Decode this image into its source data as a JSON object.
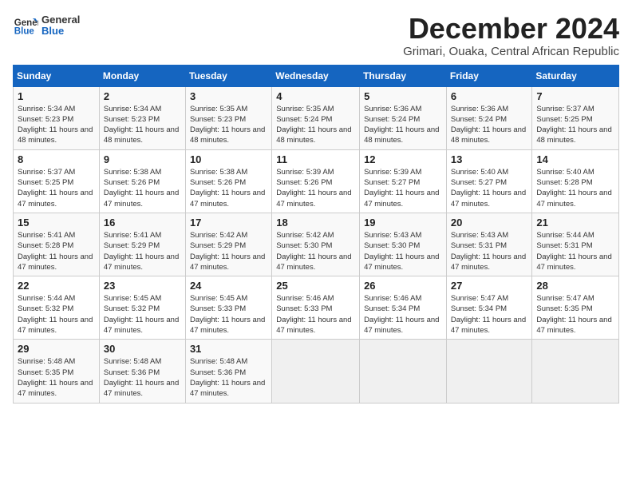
{
  "logo": {
    "general": "General",
    "blue": "Blue"
  },
  "header": {
    "month": "December 2024",
    "location": "Grimari, Ouaka, Central African Republic"
  },
  "weekdays": [
    "Sunday",
    "Monday",
    "Tuesday",
    "Wednesday",
    "Thursday",
    "Friday",
    "Saturday"
  ],
  "weeks": [
    [
      {
        "day": 1,
        "sunrise": "5:34 AM",
        "sunset": "5:23 PM",
        "daylight": "11 hours and 48 minutes."
      },
      {
        "day": 2,
        "sunrise": "5:34 AM",
        "sunset": "5:23 PM",
        "daylight": "11 hours and 48 minutes."
      },
      {
        "day": 3,
        "sunrise": "5:35 AM",
        "sunset": "5:23 PM",
        "daylight": "11 hours and 48 minutes."
      },
      {
        "day": 4,
        "sunrise": "5:35 AM",
        "sunset": "5:24 PM",
        "daylight": "11 hours and 48 minutes."
      },
      {
        "day": 5,
        "sunrise": "5:36 AM",
        "sunset": "5:24 PM",
        "daylight": "11 hours and 48 minutes."
      },
      {
        "day": 6,
        "sunrise": "5:36 AM",
        "sunset": "5:24 PM",
        "daylight": "11 hours and 48 minutes."
      },
      {
        "day": 7,
        "sunrise": "5:37 AM",
        "sunset": "5:25 PM",
        "daylight": "11 hours and 48 minutes."
      }
    ],
    [
      {
        "day": 8,
        "sunrise": "5:37 AM",
        "sunset": "5:25 PM",
        "daylight": "11 hours and 47 minutes."
      },
      {
        "day": 9,
        "sunrise": "5:38 AM",
        "sunset": "5:26 PM",
        "daylight": "11 hours and 47 minutes."
      },
      {
        "day": 10,
        "sunrise": "5:38 AM",
        "sunset": "5:26 PM",
        "daylight": "11 hours and 47 minutes."
      },
      {
        "day": 11,
        "sunrise": "5:39 AM",
        "sunset": "5:26 PM",
        "daylight": "11 hours and 47 minutes."
      },
      {
        "day": 12,
        "sunrise": "5:39 AM",
        "sunset": "5:27 PM",
        "daylight": "11 hours and 47 minutes."
      },
      {
        "day": 13,
        "sunrise": "5:40 AM",
        "sunset": "5:27 PM",
        "daylight": "11 hours and 47 minutes."
      },
      {
        "day": 14,
        "sunrise": "5:40 AM",
        "sunset": "5:28 PM",
        "daylight": "11 hours and 47 minutes."
      }
    ],
    [
      {
        "day": 15,
        "sunrise": "5:41 AM",
        "sunset": "5:28 PM",
        "daylight": "11 hours and 47 minutes."
      },
      {
        "day": 16,
        "sunrise": "5:41 AM",
        "sunset": "5:29 PM",
        "daylight": "11 hours and 47 minutes."
      },
      {
        "day": 17,
        "sunrise": "5:42 AM",
        "sunset": "5:29 PM",
        "daylight": "11 hours and 47 minutes."
      },
      {
        "day": 18,
        "sunrise": "5:42 AM",
        "sunset": "5:30 PM",
        "daylight": "11 hours and 47 minutes."
      },
      {
        "day": 19,
        "sunrise": "5:43 AM",
        "sunset": "5:30 PM",
        "daylight": "11 hours and 47 minutes."
      },
      {
        "day": 20,
        "sunrise": "5:43 AM",
        "sunset": "5:31 PM",
        "daylight": "11 hours and 47 minutes."
      },
      {
        "day": 21,
        "sunrise": "5:44 AM",
        "sunset": "5:31 PM",
        "daylight": "11 hours and 47 minutes."
      }
    ],
    [
      {
        "day": 22,
        "sunrise": "5:44 AM",
        "sunset": "5:32 PM",
        "daylight": "11 hours and 47 minutes."
      },
      {
        "day": 23,
        "sunrise": "5:45 AM",
        "sunset": "5:32 PM",
        "daylight": "11 hours and 47 minutes."
      },
      {
        "day": 24,
        "sunrise": "5:45 AM",
        "sunset": "5:33 PM",
        "daylight": "11 hours and 47 minutes."
      },
      {
        "day": 25,
        "sunrise": "5:46 AM",
        "sunset": "5:33 PM",
        "daylight": "11 hours and 47 minutes."
      },
      {
        "day": 26,
        "sunrise": "5:46 AM",
        "sunset": "5:34 PM",
        "daylight": "11 hours and 47 minutes."
      },
      {
        "day": 27,
        "sunrise": "5:47 AM",
        "sunset": "5:34 PM",
        "daylight": "11 hours and 47 minutes."
      },
      {
        "day": 28,
        "sunrise": "5:47 AM",
        "sunset": "5:35 PM",
        "daylight": "11 hours and 47 minutes."
      }
    ],
    [
      {
        "day": 29,
        "sunrise": "5:48 AM",
        "sunset": "5:35 PM",
        "daylight": "11 hours and 47 minutes."
      },
      {
        "day": 30,
        "sunrise": "5:48 AM",
        "sunset": "5:36 PM",
        "daylight": "11 hours and 47 minutes."
      },
      {
        "day": 31,
        "sunrise": "5:48 AM",
        "sunset": "5:36 PM",
        "daylight": "11 hours and 47 minutes."
      },
      null,
      null,
      null,
      null
    ]
  ]
}
